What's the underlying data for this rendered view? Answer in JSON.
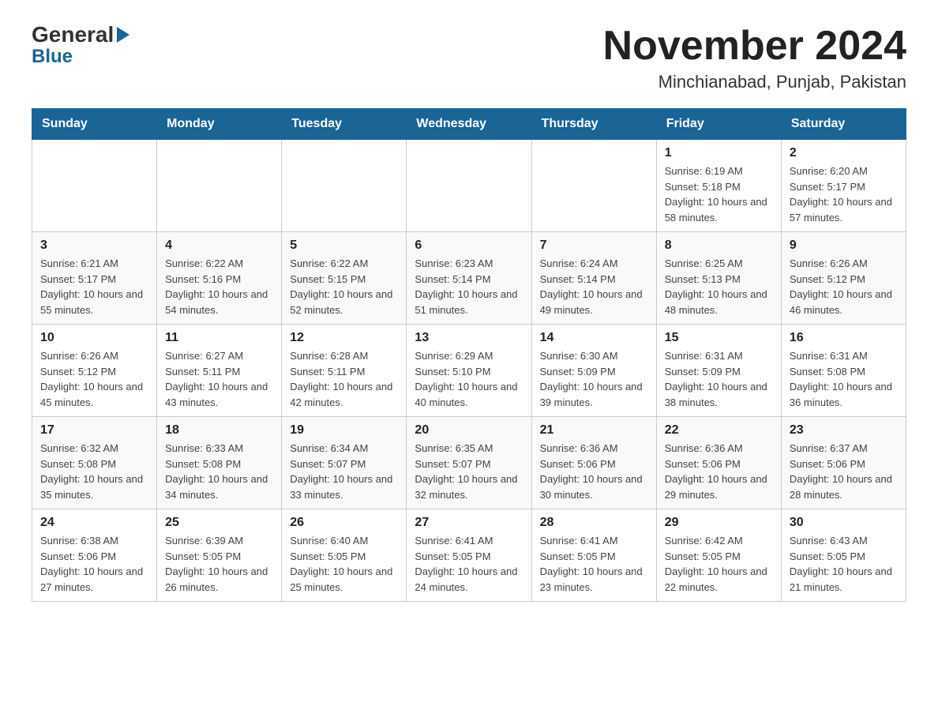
{
  "header": {
    "month_title": "November 2024",
    "location": "Minchianabad, Punjab, Pakistan",
    "logo_general": "General",
    "logo_blue": "Blue"
  },
  "calendar": {
    "days_of_week": [
      "Sunday",
      "Monday",
      "Tuesday",
      "Wednesday",
      "Thursday",
      "Friday",
      "Saturday"
    ],
    "weeks": [
      [
        {
          "day": "",
          "info": ""
        },
        {
          "day": "",
          "info": ""
        },
        {
          "day": "",
          "info": ""
        },
        {
          "day": "",
          "info": ""
        },
        {
          "day": "",
          "info": ""
        },
        {
          "day": "1",
          "info": "Sunrise: 6:19 AM\nSunset: 5:18 PM\nDaylight: 10 hours and 58 minutes."
        },
        {
          "day": "2",
          "info": "Sunrise: 6:20 AM\nSunset: 5:17 PM\nDaylight: 10 hours and 57 minutes."
        }
      ],
      [
        {
          "day": "3",
          "info": "Sunrise: 6:21 AM\nSunset: 5:17 PM\nDaylight: 10 hours and 55 minutes."
        },
        {
          "day": "4",
          "info": "Sunrise: 6:22 AM\nSunset: 5:16 PM\nDaylight: 10 hours and 54 minutes."
        },
        {
          "day": "5",
          "info": "Sunrise: 6:22 AM\nSunset: 5:15 PM\nDaylight: 10 hours and 52 minutes."
        },
        {
          "day": "6",
          "info": "Sunrise: 6:23 AM\nSunset: 5:14 PM\nDaylight: 10 hours and 51 minutes."
        },
        {
          "day": "7",
          "info": "Sunrise: 6:24 AM\nSunset: 5:14 PM\nDaylight: 10 hours and 49 minutes."
        },
        {
          "day": "8",
          "info": "Sunrise: 6:25 AM\nSunset: 5:13 PM\nDaylight: 10 hours and 48 minutes."
        },
        {
          "day": "9",
          "info": "Sunrise: 6:26 AM\nSunset: 5:12 PM\nDaylight: 10 hours and 46 minutes."
        }
      ],
      [
        {
          "day": "10",
          "info": "Sunrise: 6:26 AM\nSunset: 5:12 PM\nDaylight: 10 hours and 45 minutes."
        },
        {
          "day": "11",
          "info": "Sunrise: 6:27 AM\nSunset: 5:11 PM\nDaylight: 10 hours and 43 minutes."
        },
        {
          "day": "12",
          "info": "Sunrise: 6:28 AM\nSunset: 5:11 PM\nDaylight: 10 hours and 42 minutes."
        },
        {
          "day": "13",
          "info": "Sunrise: 6:29 AM\nSunset: 5:10 PM\nDaylight: 10 hours and 40 minutes."
        },
        {
          "day": "14",
          "info": "Sunrise: 6:30 AM\nSunset: 5:09 PM\nDaylight: 10 hours and 39 minutes."
        },
        {
          "day": "15",
          "info": "Sunrise: 6:31 AM\nSunset: 5:09 PM\nDaylight: 10 hours and 38 minutes."
        },
        {
          "day": "16",
          "info": "Sunrise: 6:31 AM\nSunset: 5:08 PM\nDaylight: 10 hours and 36 minutes."
        }
      ],
      [
        {
          "day": "17",
          "info": "Sunrise: 6:32 AM\nSunset: 5:08 PM\nDaylight: 10 hours and 35 minutes."
        },
        {
          "day": "18",
          "info": "Sunrise: 6:33 AM\nSunset: 5:08 PM\nDaylight: 10 hours and 34 minutes."
        },
        {
          "day": "19",
          "info": "Sunrise: 6:34 AM\nSunset: 5:07 PM\nDaylight: 10 hours and 33 minutes."
        },
        {
          "day": "20",
          "info": "Sunrise: 6:35 AM\nSunset: 5:07 PM\nDaylight: 10 hours and 32 minutes."
        },
        {
          "day": "21",
          "info": "Sunrise: 6:36 AM\nSunset: 5:06 PM\nDaylight: 10 hours and 30 minutes."
        },
        {
          "day": "22",
          "info": "Sunrise: 6:36 AM\nSunset: 5:06 PM\nDaylight: 10 hours and 29 minutes."
        },
        {
          "day": "23",
          "info": "Sunrise: 6:37 AM\nSunset: 5:06 PM\nDaylight: 10 hours and 28 minutes."
        }
      ],
      [
        {
          "day": "24",
          "info": "Sunrise: 6:38 AM\nSunset: 5:06 PM\nDaylight: 10 hours and 27 minutes."
        },
        {
          "day": "25",
          "info": "Sunrise: 6:39 AM\nSunset: 5:05 PM\nDaylight: 10 hours and 26 minutes."
        },
        {
          "day": "26",
          "info": "Sunrise: 6:40 AM\nSunset: 5:05 PM\nDaylight: 10 hours and 25 minutes."
        },
        {
          "day": "27",
          "info": "Sunrise: 6:41 AM\nSunset: 5:05 PM\nDaylight: 10 hours and 24 minutes."
        },
        {
          "day": "28",
          "info": "Sunrise: 6:41 AM\nSunset: 5:05 PM\nDaylight: 10 hours and 23 minutes."
        },
        {
          "day": "29",
          "info": "Sunrise: 6:42 AM\nSunset: 5:05 PM\nDaylight: 10 hours and 22 minutes."
        },
        {
          "day": "30",
          "info": "Sunrise: 6:43 AM\nSunset: 5:05 PM\nDaylight: 10 hours and 21 minutes."
        }
      ]
    ]
  },
  "colors": {
    "header_bg": "#1a6496",
    "header_text": "#ffffff",
    "accent_blue": "#1a6496"
  }
}
